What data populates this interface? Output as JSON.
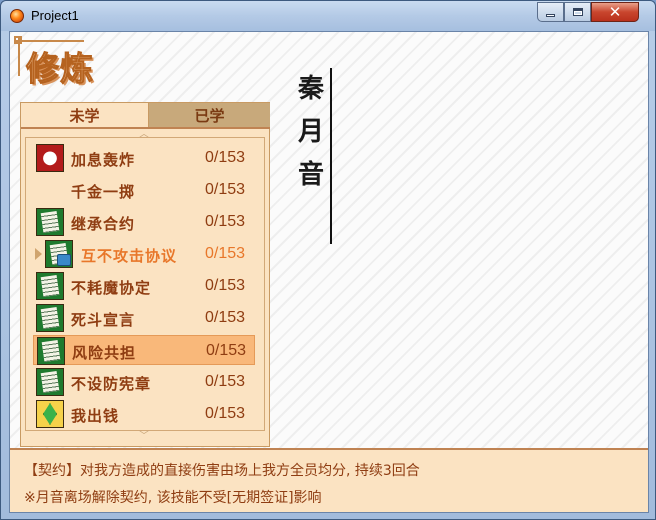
{
  "window": {
    "title": "Project1",
    "close_glyph": "✕"
  },
  "heading": "修炼",
  "tabs": [
    {
      "label": "未学"
    },
    {
      "label": "已学"
    }
  ],
  "skills": [
    {
      "name": "加息轰炸",
      "count": "0/153",
      "icon": "apple-icon"
    },
    {
      "name": "千金一掷",
      "count": "0/153",
      "icon": "none"
    },
    {
      "name": "继承合约",
      "count": "0/153",
      "icon": "scroll-icon"
    },
    {
      "name": "互不攻击协议",
      "count": "0/153",
      "icon": "scroll-icon"
    },
    {
      "name": "不耗魔协定",
      "count": "0/153",
      "icon": "scroll-icon"
    },
    {
      "name": "死斗宣言",
      "count": "0/153",
      "icon": "scroll-icon"
    },
    {
      "name": "风险共担",
      "count": "0/153",
      "icon": "scroll-icon"
    },
    {
      "name": "不设防宪章",
      "count": "0/153",
      "icon": "scroll-icon"
    },
    {
      "name": "我出钱",
      "count": "0/153",
      "icon": "gem-icon"
    }
  ],
  "character": {
    "name": [
      "秦",
      "月",
      "音"
    ]
  },
  "description": {
    "line1": "【契约】对我方造成的直接伤害由场上我方全员均分, 持续3回合",
    "line2": "※月音离场解除契约, 该技能不受[无期签证]影响"
  },
  "colors": {
    "accent": "#8f3d12",
    "highlight": "#e8772a",
    "selected_row": "#f9b87a",
    "panel": "#fbe3c2"
  }
}
